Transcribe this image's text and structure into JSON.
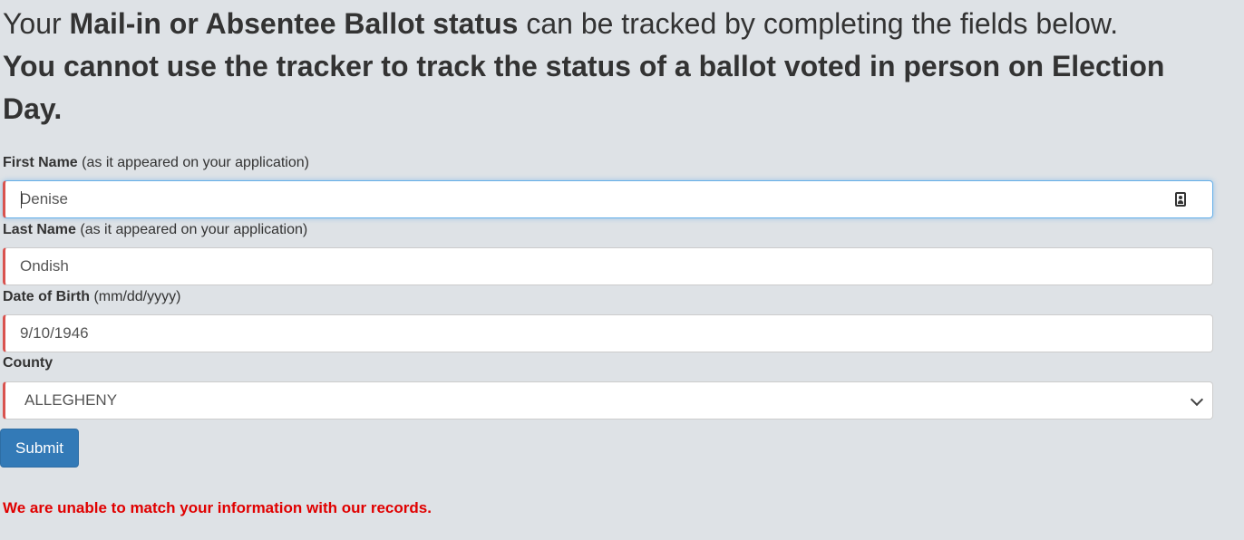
{
  "intro": {
    "line1_pre": "Your ",
    "line1_bold": "Mail-in or Absentee Ballot status",
    "line1_post": " can be tracked by completing the fields below.",
    "line2": "You cannot use the tracker to track the status of a ballot voted in person on Election Day."
  },
  "form": {
    "first_name": {
      "label": "First Name",
      "hint": "(as it appeared on your application)",
      "value": "Denise"
    },
    "last_name": {
      "label": "Last Name",
      "hint": "(as it appeared on your application)",
      "value": "Ondish"
    },
    "dob": {
      "label": "Date of Birth",
      "hint": "(mm/dd/yyyy)",
      "value": "9/10/1946"
    },
    "county": {
      "label": "County",
      "selected": "ALLEGHENY"
    },
    "submit_label": "Submit"
  },
  "error_message": "We are unable to match your information with our records.",
  "colors": {
    "background": "#dee2e6",
    "invalid_border": "#d9534f",
    "focus_border": "#66afe9",
    "button": "#337ab7",
    "error_text": "#e00000"
  },
  "icons": {
    "autofill": "contact-card-icon",
    "select": "chevron-down-icon"
  }
}
